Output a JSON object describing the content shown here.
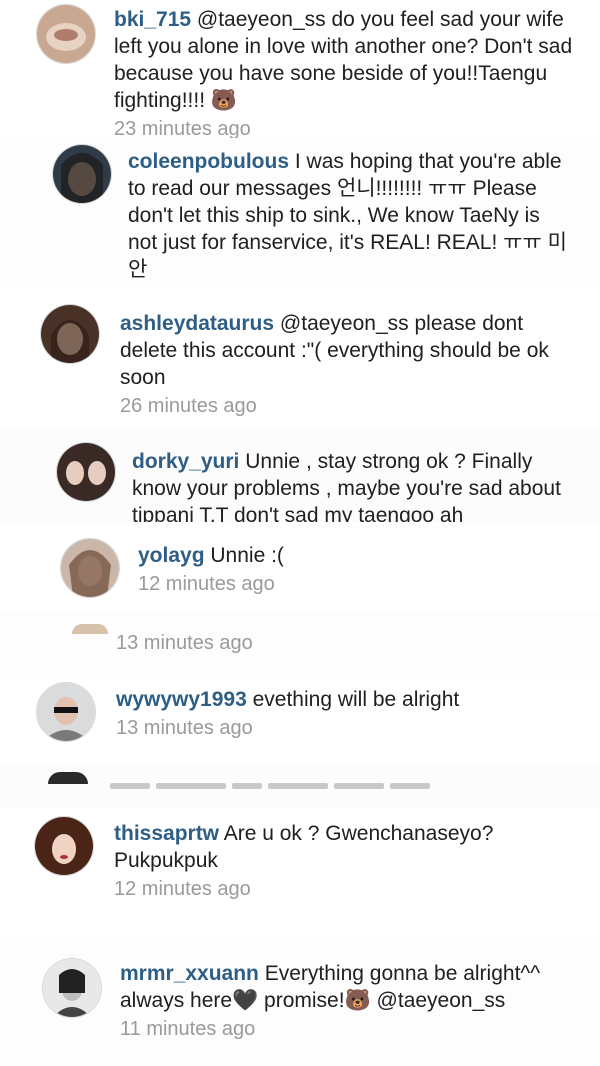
{
  "comments": [
    {
      "user": "bki_715",
      "text": "@taeyeon_ss do you feel sad your wife left you alone in love with another one? Don't sad because you have sone beside of you!!Taengu fighting!!!! 🐻",
      "time": "23 minutes ago"
    },
    {
      "user": "coleenpobulous",
      "text": "I was hoping that you're able to read our messages 언니!!!!!!!! ㅠㅠ Please don't let this ship to sink., We know TaeNy is not just for fanservice, it's REAL! REAL! ㅠㅠ 미안",
      "time": ""
    },
    {
      "user": "ashleydataurus",
      "text": "@taeyeon_ss  please dont delete this account :\"( everything should be ok soon",
      "time": "26 minutes ago"
    },
    {
      "user": "dorky_yuri",
      "text": "Unnie , stay strong ok ? Finally know your problems , maybe you're sad about tippani T.T don't sad my taengoo ah",
      "time": ""
    },
    {
      "user": "yolayg",
      "text": "Unnie :(",
      "time": "12 minutes ago"
    },
    {
      "user": "",
      "text": "",
      "time": "13 minutes ago"
    },
    {
      "user": "wywywy1993",
      "text": "evething will be alright",
      "time": "13 minutes ago"
    },
    {
      "user": "thissaprtw",
      "text": "Are u ok ? Gwenchanaseyo? Pukpukpuk",
      "time": "12 minutes ago"
    },
    {
      "user": "mrmr_xxuann",
      "text": "Everything gonna be alright^^ always here🖤 promise!🐻 @taeyeon_ss",
      "time": "11 minutes ago"
    }
  ]
}
